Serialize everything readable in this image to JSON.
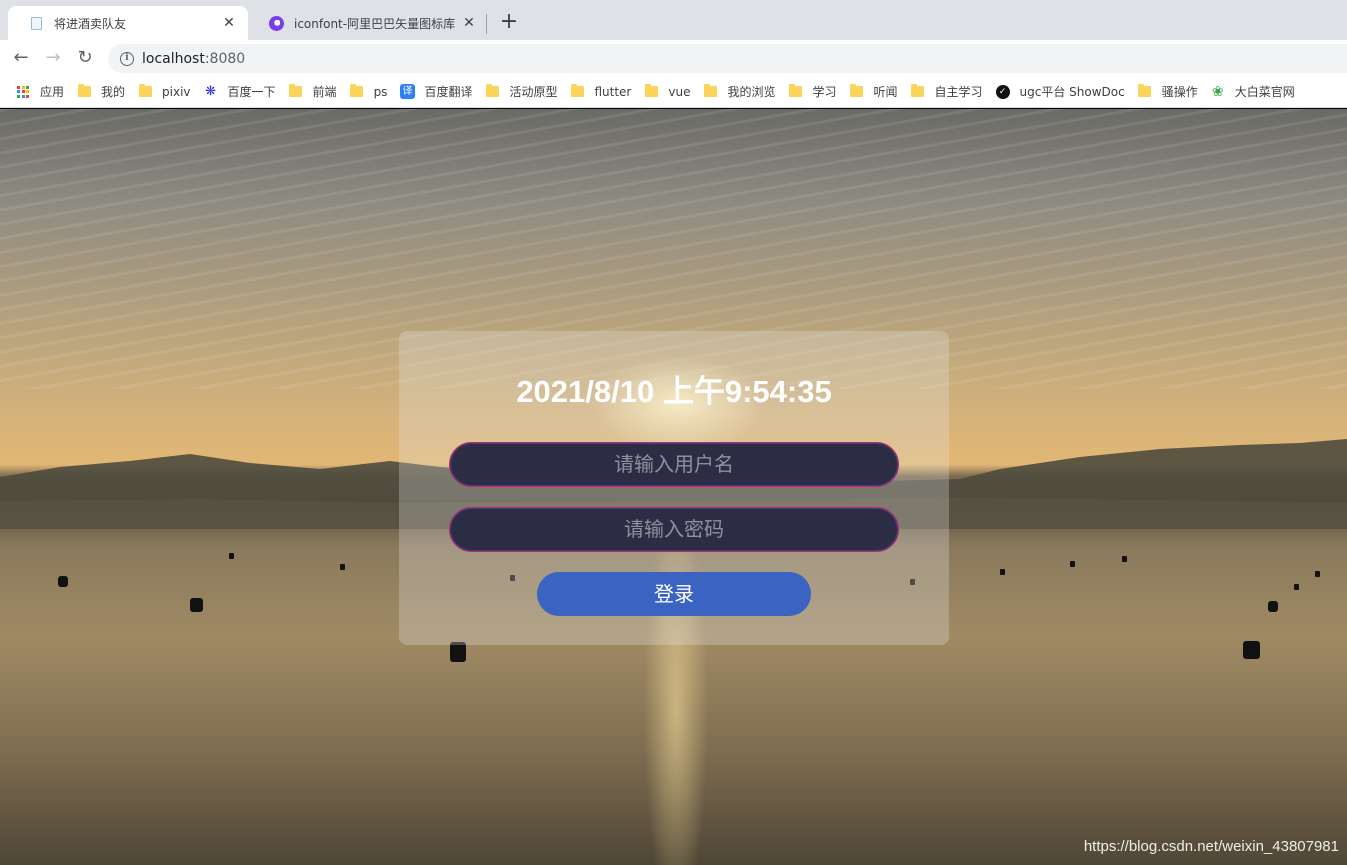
{
  "tabs": [
    {
      "title": "将进酒卖队友",
      "close": "✕",
      "favicon": "page-icon"
    },
    {
      "title": "iconfont-阿里巴巴矢量图标库",
      "close": "✕",
      "favicon": "iconfont-icon"
    }
  ],
  "new_tab_label": "+",
  "nav": {
    "back": "←",
    "forward": "→",
    "reload": "↻"
  },
  "address": {
    "host": "localhost",
    "port": ":8080",
    "info_glyph": "i"
  },
  "bookmarks": [
    {
      "label": "应用",
      "icon": "apps-grid-icon"
    },
    {
      "label": "我的",
      "icon": "folder-icon"
    },
    {
      "label": "pixiv",
      "icon": "folder-icon"
    },
    {
      "label": "百度一下",
      "icon": "baidu-icon"
    },
    {
      "label": "前端",
      "icon": "folder-icon"
    },
    {
      "label": "ps",
      "icon": "folder-icon"
    },
    {
      "label": "百度翻译",
      "icon": "baidu-translate-icon"
    },
    {
      "label": "活动原型",
      "icon": "folder-icon"
    },
    {
      "label": "flutter",
      "icon": "folder-icon"
    },
    {
      "label": "vue",
      "icon": "folder-icon"
    },
    {
      "label": "我的浏览",
      "icon": "folder-icon"
    },
    {
      "label": "学习",
      "icon": "folder-icon"
    },
    {
      "label": "听闻",
      "icon": "folder-icon"
    },
    {
      "label": "自主学习",
      "icon": "folder-icon"
    },
    {
      "label": "ugc平台 ShowDoc",
      "icon": "ugc-icon"
    },
    {
      "label": "骚操作",
      "icon": "folder-icon"
    },
    {
      "label": "大白菜官网",
      "icon": "dabaicai-icon"
    }
  ],
  "login": {
    "clock": "2021/8/10 上午9:54:35",
    "username_placeholder": "请输入用户名",
    "password_placeholder": "请输入密码",
    "submit_label": "登录"
  },
  "watermark": "https://blog.csdn.net/weixin_43807981",
  "colors": {
    "panel_bg": "rgba(230,230,230,0.28)",
    "input_bg": "#2c2d44",
    "input_border": "#c2265b",
    "button_bg": "#3b63c2",
    "folder": "#fbd45b"
  }
}
